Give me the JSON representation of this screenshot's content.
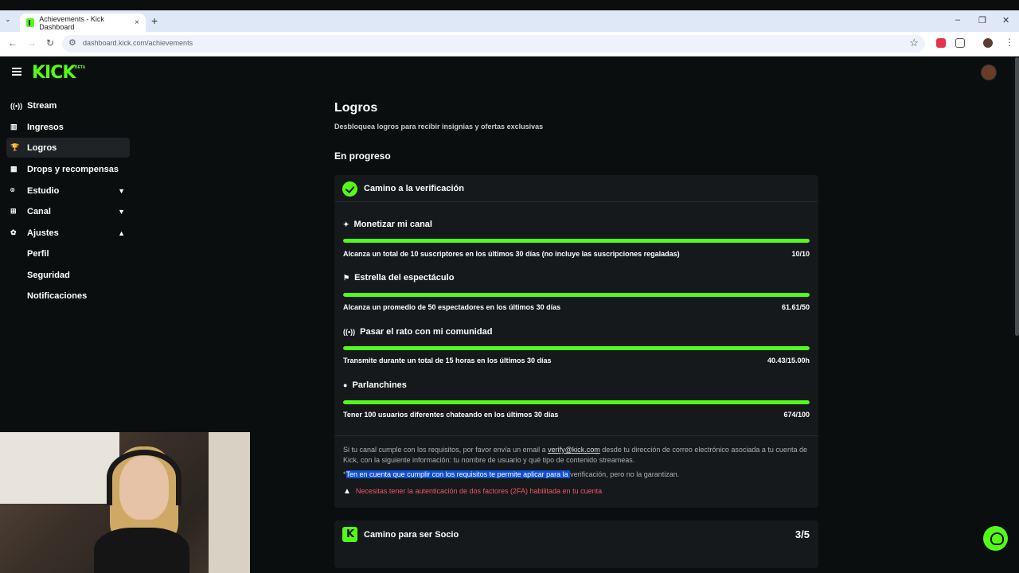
{
  "browser": {
    "tab_title": "Achievements - Kick Dashboard",
    "url": "dashboard.kick.com/achievements"
  },
  "header": {
    "logo": "KICK",
    "beta": "BETA"
  },
  "sidebar": {
    "items": [
      {
        "label": "Stream",
        "icon": "broadcast-icon"
      },
      {
        "label": "Ingresos",
        "icon": "chart-icon"
      },
      {
        "label": "Logros",
        "icon": "trophy-icon",
        "active": true
      },
      {
        "label": "Drops y recompensas",
        "icon": "gift-icon"
      },
      {
        "label": "Estudio",
        "icon": "studio-icon",
        "chevron": "down"
      },
      {
        "label": "Canal",
        "icon": "channel-icon",
        "chevron": "down"
      },
      {
        "label": "Ajustes",
        "icon": "gear-icon",
        "chevron": "up"
      }
    ],
    "subitems": [
      "Perfil",
      "Seguridad",
      "Notificaciones"
    ]
  },
  "main": {
    "title": "Logros",
    "subtitle": "Desbloquea logros para recibir insignias y ofertas exclusivas",
    "section": "En progreso",
    "card": {
      "title": "Camino a la verificación",
      "requirements": [
        {
          "name": "Monetizar mi canal",
          "icon": "sparkle-icon",
          "desc": "Alcanza un total de 10 suscriptores en los últimos 30 días (no incluye las suscripciones regaladas)",
          "value": "10/10",
          "progress": 1.0
        },
        {
          "name": "Estrella del espectáculo",
          "icon": "star-person-icon",
          "desc": "Alcanza un promedio de 50 espectadores en los últimos 30 días",
          "value": "61.61/50",
          "progress": 1.0
        },
        {
          "name": "Pasar el rato con mi comunidad",
          "icon": "broadcast-icon",
          "desc": "Transmite durante un total de 15 horas en los últimos 30 días",
          "value": "40.43/15.00h",
          "progress": 1.0
        },
        {
          "name": "Parlanchines",
          "icon": "chat-icon",
          "desc": "Tener 100 usuarios diferentes chateando en los últimos 30 días",
          "value": "674/100",
          "progress": 1.0
        }
      ],
      "info_before": "Si tu canal cumple con los requisitos, por favor envía un email a ",
      "info_email": "verify@kick.com",
      "info_after": " desde tu dirección de correo electrónico asociada a tu cuenta de Kick, con la siguiente información: tu nombre de usuario y qué tipo de contenido streameas.",
      "note_prefix": "*",
      "note_highlight": "Ten en cuenta que cumplir con los requisitos te permite aplicar para la ",
      "note_rest": "verificación, pero no la garantizan.",
      "warning": "Necesitas tener la autenticación de dos factores (2FA) habilitada en tu cuenta"
    },
    "card2": {
      "title": "Camino para ser Socio",
      "count": "3/5"
    }
  },
  "colors": {
    "accent": "#53fc18",
    "background": "#0b0e0f",
    "card": "#16191b",
    "warning": "#f0556a",
    "highlight": "#0d4fd8"
  }
}
